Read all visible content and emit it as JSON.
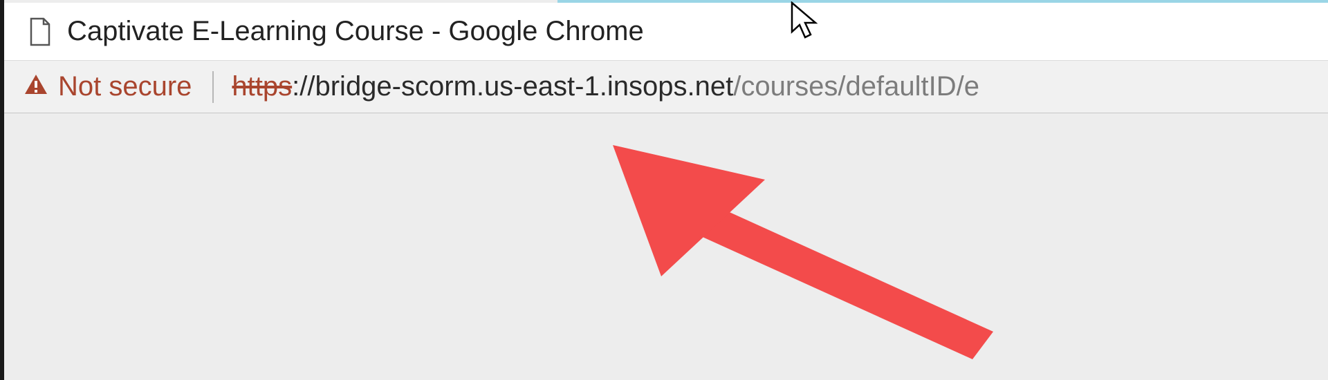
{
  "window": {
    "title": "Captivate E-Learning Course - Google Chrome"
  },
  "address": {
    "security_label": "Not secure",
    "url_scheme": "https",
    "url_sep": "://",
    "url_host": "bridge-scorm.us-east-1.insops.net",
    "url_path": "/courses/defaultID/e"
  },
  "icons": {
    "page": "page-icon",
    "warning": "warning-triangle-icon",
    "cursor": "cursor-icon",
    "arrow": "annotation-arrow-icon"
  }
}
